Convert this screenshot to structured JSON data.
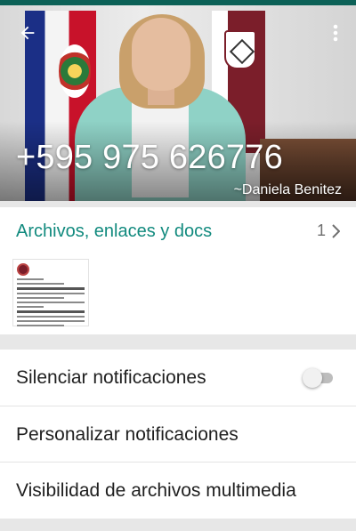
{
  "header": {
    "phone_number": "+595 975 626776",
    "contact_name": "~Daniela Benitez",
    "icons": {
      "back": "arrow-back-icon",
      "menu": "more-vert-icon"
    }
  },
  "media": {
    "title": "Archivos, enlaces y docs",
    "count": "1",
    "count_icon": "chevron-right-icon",
    "accent_color": "#118a7e"
  },
  "settings": {
    "items": [
      {
        "label": "Silenciar notificaciones",
        "toggle_on": false
      },
      {
        "label": "Personalizar notificaciones"
      },
      {
        "label": "Visibilidad de archivos multimedia"
      }
    ]
  },
  "colors": {
    "status_bar": "#0c6157",
    "background": "#e7e7e7"
  }
}
